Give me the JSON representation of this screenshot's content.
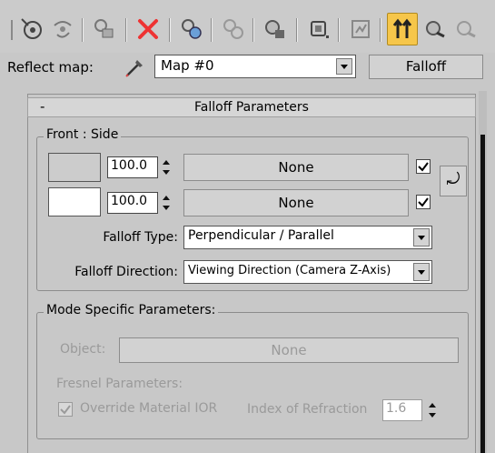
{
  "toolbar": {
    "icons": [
      "pick-object-icon",
      "show-in-viewport-icon",
      "assign-material-icon",
      "delete-icon",
      "make-unique-icon",
      "put-to-library-icon",
      "material-effects-icon",
      "show-end-result-icon",
      "go-to-parent-icon",
      "go-forward-icon",
      "go-to-sibling-icon",
      "show-map-icon"
    ],
    "active_icon": "show-end-result-icon"
  },
  "reflect_map": {
    "label": "Reflect map:",
    "map_value": "Map #0",
    "type_button": "Falloff"
  },
  "rollout": {
    "collapse_symbol": "-",
    "title": "Falloff Parameters"
  },
  "front_side": {
    "group_title": "Front : Side",
    "rows": [
      {
        "swatch_color": "#cccccc",
        "amount": "100.0",
        "map": "None",
        "checked": true
      },
      {
        "swatch_color": "#ffffff",
        "amount": "100.0",
        "map": "None",
        "checked": true
      }
    ],
    "swap_symbol": "⤾",
    "falloff_type_label": "Falloff Type:",
    "falloff_type_value": "Perpendicular / Parallel",
    "falloff_direction_label": "Falloff Direction:",
    "falloff_direction_value": "Viewing Direction (Camera Z-Axis)"
  },
  "mode_specific": {
    "group_title": "Mode Specific Parameters:",
    "object_label": "Object:",
    "object_value": "None",
    "fresnel_label": "Fresnel Parameters:",
    "override_ior_label": "Override Material IOR",
    "override_ior_checked": true,
    "ior_label": "Index of Refraction",
    "ior_value": "1.6"
  },
  "colors": {
    "panel": "#c8c8c8",
    "active_button": "#f6c64a"
  }
}
